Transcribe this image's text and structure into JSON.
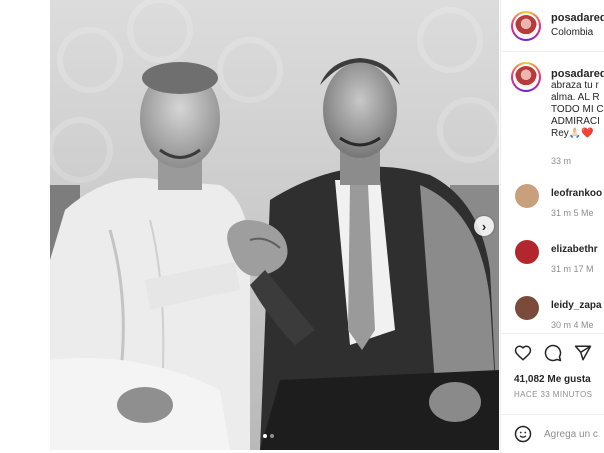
{
  "post": {
    "username": "posadaredc",
    "location": "Colombia",
    "caption_lines": [
      "abraza tu r",
      "alma. AL R",
      "TODO MI C",
      "ADMIRACI",
      "Rey🙏🏻❤️"
    ],
    "caption_time": "33 m",
    "carousel_dots": 2,
    "active_dot": 0
  },
  "comments": [
    {
      "user": "leofrankoo",
      "meta": "31 m   5 Me",
      "avatar_color": "#c9a07e"
    },
    {
      "user": "elizabethr",
      "meta": "31 m   17 M",
      "avatar_color": "#b3262e"
    },
    {
      "user": "leidy_zapa",
      "meta": "30 m   4 Me",
      "avatar_color": "#7a4a3a"
    }
  ],
  "actions": {
    "likes": "41,082 Me gusta",
    "posted": "HACE 33 MINUTOS",
    "comment_placeholder": "Agrega un c"
  },
  "icons": {
    "like": "heart-icon",
    "comment": "comment-bubble-icon",
    "share": "paper-plane-icon",
    "emoji": "smiley-icon",
    "next": "chevron-right-icon"
  }
}
